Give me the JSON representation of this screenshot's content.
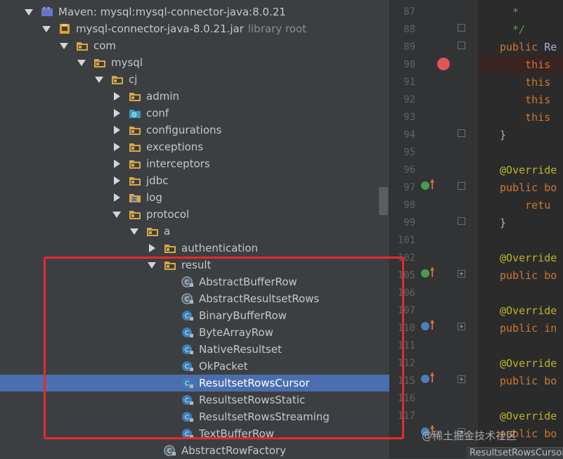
{
  "tree": {
    "items": [
      {
        "label": "Maven: mysql:mysql-connector-java:8.0.21",
        "sub": "",
        "icon": "library-icon",
        "arrow": "down"
      },
      {
        "label": "mysql-connector-java-8.0.21.jar",
        "sub": "library root",
        "icon": "jar-icon",
        "arrow": "down"
      },
      {
        "label": "com",
        "sub": "",
        "icon": "package-folder-icon",
        "arrow": "down"
      },
      {
        "label": "mysql",
        "sub": "",
        "icon": "package-folder-icon",
        "arrow": "down"
      },
      {
        "label": "cj",
        "sub": "",
        "icon": "package-folder-icon",
        "arrow": "down"
      },
      {
        "label": "admin",
        "sub": "",
        "icon": "package-folder-icon",
        "arrow": "right"
      },
      {
        "label": "conf",
        "sub": "",
        "icon": "config-package-icon",
        "arrow": "right"
      },
      {
        "label": "configurations",
        "sub": "",
        "icon": "package-folder-icon",
        "arrow": "right"
      },
      {
        "label": "exceptions",
        "sub": "",
        "icon": "package-folder-icon",
        "arrow": "right"
      },
      {
        "label": "interceptors",
        "sub": "",
        "icon": "package-folder-icon",
        "arrow": "right"
      },
      {
        "label": "jdbc",
        "sub": "",
        "icon": "package-folder-icon",
        "arrow": "right"
      },
      {
        "label": "log",
        "sub": "",
        "icon": "log-package-icon",
        "arrow": "right"
      },
      {
        "label": "protocol",
        "sub": "",
        "icon": "package-folder-icon",
        "arrow": "down"
      },
      {
        "label": "a",
        "sub": "",
        "icon": "package-folder-icon",
        "arrow": "down"
      },
      {
        "label": "authentication",
        "sub": "",
        "icon": "package-folder-icon",
        "arrow": "right"
      },
      {
        "label": "result",
        "sub": "",
        "icon": "package-folder-icon",
        "arrow": "down"
      },
      {
        "label": "AbstractBufferRow",
        "sub": "",
        "icon": "abstract-class-icon",
        "arrow": ""
      },
      {
        "label": "AbstractResultsetRows",
        "sub": "",
        "icon": "abstract-class-icon",
        "arrow": ""
      },
      {
        "label": "BinaryBufferRow",
        "sub": "",
        "icon": "class-icon",
        "arrow": ""
      },
      {
        "label": "ByteArrayRow",
        "sub": "",
        "icon": "class-icon",
        "arrow": ""
      },
      {
        "label": "NativeResultset",
        "sub": "",
        "icon": "class-icon",
        "arrow": ""
      },
      {
        "label": "OkPacket",
        "sub": "",
        "icon": "class-icon",
        "arrow": ""
      },
      {
        "label": "ResultsetRowsCursor",
        "sub": "",
        "icon": "class-icon",
        "arrow": "",
        "selected": true
      },
      {
        "label": "ResultsetRowsStatic",
        "sub": "",
        "icon": "class-icon",
        "arrow": ""
      },
      {
        "label": "ResultsetRowsStreaming",
        "sub": "",
        "icon": "class-icon",
        "arrow": ""
      },
      {
        "label": "TextBufferRow",
        "sub": "",
        "icon": "class-icon",
        "arrow": ""
      },
      {
        "label": "AbstractRowFactory",
        "sub": "",
        "icon": "abstract-class-icon",
        "arrow": ""
      }
    ]
  },
  "gutter": {
    "line_numbers": [
      "87",
      "88",
      "89",
      "90",
      "91",
      "92",
      "93",
      "94",
      "95",
      "96",
      "97",
      "98",
      "99",
      "101",
      "102",
      "105",
      "106",
      "107",
      "110",
      "111",
      "112",
      "115",
      "116",
      "117"
    ]
  },
  "code": {
    "lines": [
      {
        "parts": [
          {
            "t": "  *",
            "c": "cm"
          }
        ]
      },
      {
        "parts": [
          {
            "t": "  */",
            "c": "cm"
          }
        ]
      },
      {
        "parts": [
          {
            "t": "public ",
            "c": "kw"
          },
          {
            "t": "Re",
            "c": "pl"
          }
        ]
      },
      {
        "parts": [
          {
            "t": "    this",
            "c": "kw"
          }
        ]
      },
      {
        "parts": [
          {
            "t": "    this",
            "c": "kw"
          }
        ]
      },
      {
        "parts": [
          {
            "t": "    this",
            "c": "kw"
          }
        ]
      },
      {
        "parts": [
          {
            "t": "    this",
            "c": "kw"
          }
        ]
      },
      {
        "parts": [
          {
            "t": "}",
            "c": "pl"
          }
        ]
      },
      {
        "parts": []
      },
      {
        "parts": [
          {
            "t": "@Override",
            "c": "an"
          }
        ]
      },
      {
        "parts": [
          {
            "t": "public ",
            "c": "kw"
          },
          {
            "t": "bo",
            "c": "kw"
          }
        ]
      },
      {
        "parts": [
          {
            "t": "    retu",
            "c": "kw"
          }
        ]
      },
      {
        "parts": [
          {
            "t": "}",
            "c": "pl"
          }
        ]
      },
      {
        "parts": []
      },
      {
        "parts": [
          {
            "t": "@Override",
            "c": "an"
          }
        ]
      },
      {
        "parts": [
          {
            "t": "public ",
            "c": "kw"
          },
          {
            "t": "bo",
            "c": "kw"
          }
        ]
      },
      {
        "parts": []
      },
      {
        "parts": [
          {
            "t": "@Override",
            "c": "an"
          }
        ]
      },
      {
        "parts": [
          {
            "t": "public ",
            "c": "kw"
          },
          {
            "t": "in",
            "c": "kw"
          }
        ]
      },
      {
        "parts": []
      },
      {
        "parts": [
          {
            "t": "@Override",
            "c": "an"
          }
        ]
      },
      {
        "parts": [
          {
            "t": "public ",
            "c": "kw"
          },
          {
            "t": "bo",
            "c": "kw"
          }
        ]
      },
      {
        "parts": []
      },
      {
        "parts": [
          {
            "t": "@Override",
            "c": "an"
          }
        ]
      },
      {
        "parts": [
          {
            "t": "public ",
            "c": "kw"
          },
          {
            "t": "bo",
            "c": "kw"
          }
        ]
      }
    ]
  },
  "editor_tab": {
    "label": "ResultsetRowsCursor"
  },
  "watermark": {
    "text": "@稀土掘金技术社区"
  },
  "colors": {
    "selection": "#4b6eaf",
    "highlight_box": "#e8292b",
    "breakpoint": "#e05555"
  }
}
